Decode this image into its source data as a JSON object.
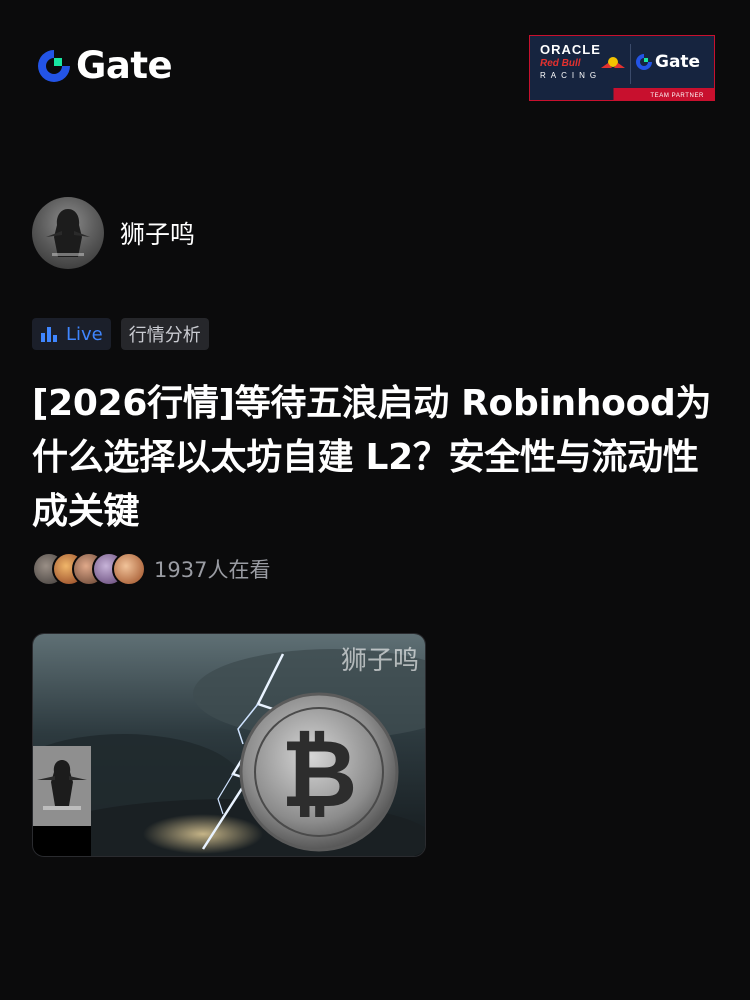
{
  "header": {
    "brand_name": "Gate",
    "brand_color": "#2354e6",
    "brand_accent": "#17e6a1",
    "partner_badge": {
      "oracle": "ORACLE",
      "redbull": "Red Bull",
      "racing": "RACING",
      "gate": "Gate",
      "strip": "TEAM PARTNER"
    }
  },
  "author": {
    "name": "狮子鸣",
    "avatar_icon": "hooded-figure-avatar"
  },
  "tags": {
    "live_label": "Live",
    "live_icon": "bar-chart-icon",
    "live_color": "#3f86ff",
    "topic_label": "行情分析"
  },
  "post": {
    "title": "[2026行情]等待五浪启动 Robinhood为什么选择以太坊自建 L2？安全性与流动性成关键"
  },
  "viewers": {
    "count_text": "1937人在看",
    "avatars": [
      "viewer-1",
      "viewer-2",
      "viewer-3",
      "viewer-4",
      "viewer-5"
    ]
  },
  "media": {
    "watermark": "狮子鸣",
    "image_subject": "bitcoin-coin-lightning-storm",
    "pip_subject": "hooded-figure-video"
  }
}
